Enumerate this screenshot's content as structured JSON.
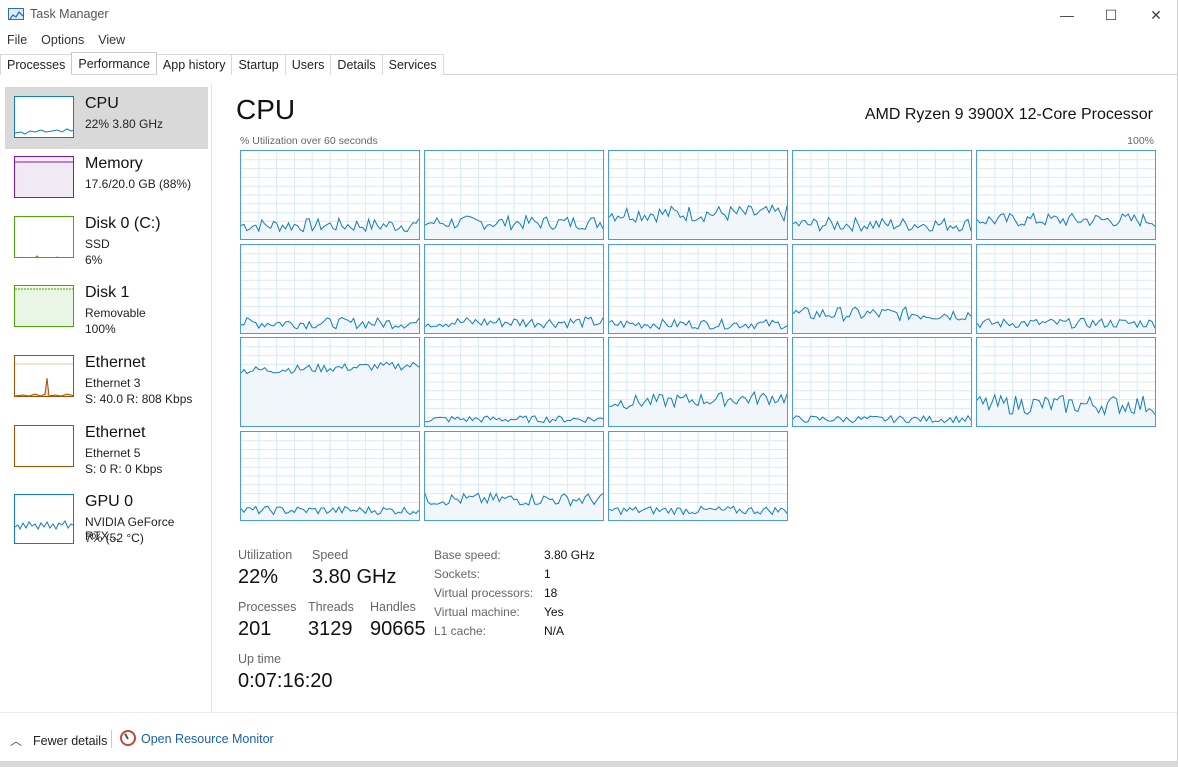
{
  "window": {
    "title": "Task Manager",
    "controls": {
      "minimize": "—",
      "maximize": "☐",
      "close": "✕"
    }
  },
  "menu": [
    "File",
    "Options",
    "View"
  ],
  "tabs": [
    "Processes",
    "Performance",
    "App history",
    "Startup",
    "Users",
    "Details",
    "Services"
  ],
  "active_tab": "Performance",
  "sidebar": [
    {
      "title": "CPU",
      "lines": [
        "22% 3.80 GHz"
      ],
      "color": "#117dbb",
      "selected": true,
      "icon": "cpu-thumbnail"
    },
    {
      "title": "Memory",
      "lines": [
        "17.6/20.0 GB (88%)"
      ],
      "color": "#8b12ae",
      "icon": "memory-thumbnail"
    },
    {
      "title": "Disk 0 (C:)",
      "lines": [
        "SSD",
        "6%"
      ],
      "color": "#4da60c",
      "icon": "disk-thumbnail"
    },
    {
      "title": "Disk 1",
      "lines": [
        "Removable",
        "100%"
      ],
      "color": "#4da60c",
      "icon": "disk-thumbnail"
    },
    {
      "title": "Ethernet",
      "lines": [
        "Ethernet 3",
        "S: 40.0  R: 808 Kbps"
      ],
      "color": "#a74f01",
      "icon": "ethernet-thumbnail"
    },
    {
      "title": "Ethernet",
      "lines": [
        "Ethernet 5",
        "S: 0  R: 0 Kbps"
      ],
      "color": "#a74f01",
      "icon": "ethernet-thumbnail"
    },
    {
      "title": "GPU 0",
      "lines": [
        "NVIDIA GeForce RTX...",
        "7% (52 °C)"
      ],
      "color": "#117dbb",
      "icon": "gpu-thumbnail"
    }
  ],
  "main": {
    "title": "CPU",
    "processor": "AMD Ryzen 9 3900X 12-Core Processor",
    "util_label": "% Utilization over 60 seconds",
    "util_max": "100%",
    "core_count": 18
  },
  "stats": {
    "utilization_label": "Utilization",
    "utilization": "22%",
    "speed_label": "Speed",
    "speed": "3.80 GHz",
    "processes_label": "Processes",
    "processes": "201",
    "threads_label": "Threads",
    "threads": "3129",
    "handles_label": "Handles",
    "handles": "90665",
    "uptime_label": "Up time",
    "uptime": "0:07:16:20"
  },
  "details": [
    {
      "key": "Base speed:",
      "value": "3.80 GHz"
    },
    {
      "key": "Sockets:",
      "value": "1"
    },
    {
      "key": "Virtual processors:",
      "value": "18"
    },
    {
      "key": "Virtual machine:",
      "value": "Yes"
    },
    {
      "key": "L1 cache:",
      "value": "N/A"
    }
  ],
  "footer": {
    "fewer_details": "Fewer details",
    "resource_monitor": "Open Resource Monitor"
  },
  "colors": {
    "cpu_line": "#117dbb",
    "cpu_fill": "#f1f6fa",
    "grid": "#d9eaf7",
    "link": "#1a5fb4"
  }
}
